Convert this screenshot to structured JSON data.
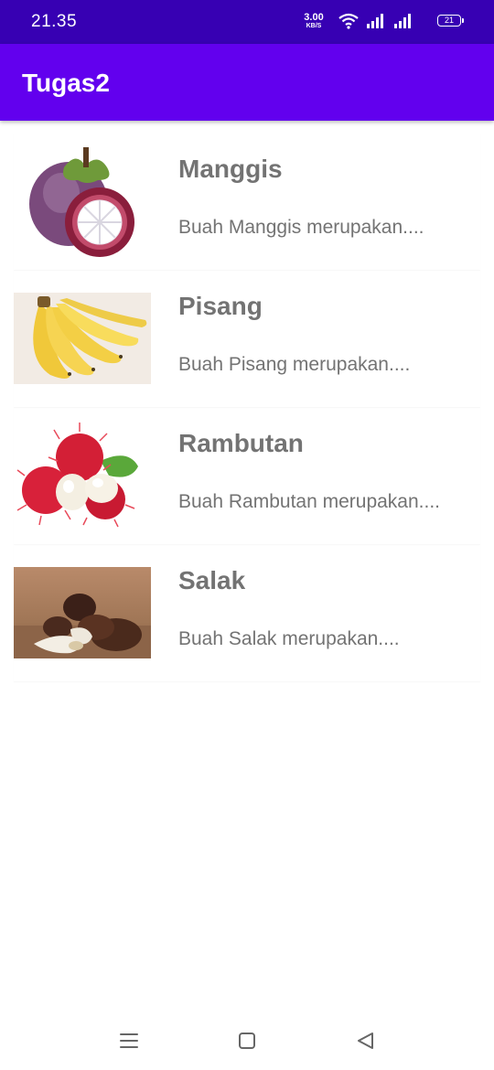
{
  "status_bar": {
    "time": "21.35",
    "net_speed_value": "3.00",
    "net_speed_unit": "KB/S",
    "battery": "21",
    "icons": [
      "wifi-icon",
      "signal-icon",
      "signal-icon",
      "battery-icon"
    ]
  },
  "app_bar": {
    "title": "Tugas2",
    "color": "#6200ee",
    "status_color": "#3700b3"
  },
  "fruits": [
    {
      "name": "Manggis",
      "description": "Buah Manggis merupakan....",
      "image": "mangosteen-image"
    },
    {
      "name": "Pisang",
      "description": "Buah Pisang merupakan....",
      "image": "banana-image"
    },
    {
      "name": "Rambutan",
      "description": "Buah Rambutan merupakan....",
      "image": "rambutan-image"
    },
    {
      "name": "Salak",
      "description": "Buah Salak merupakan....",
      "image": "salak-image"
    }
  ],
  "nav_bar": {
    "icons": [
      "menu-icon",
      "home-icon",
      "back-icon"
    ]
  }
}
